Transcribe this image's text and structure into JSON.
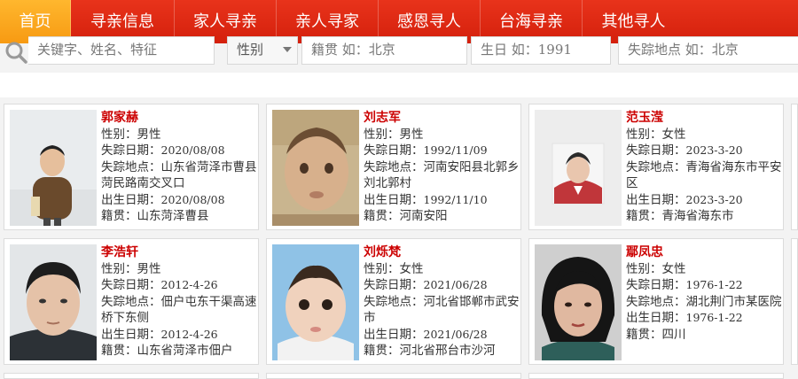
{
  "nav": {
    "items": [
      {
        "label": "首页",
        "active": true
      },
      {
        "label": "寻亲信息"
      },
      {
        "label": "家人寻亲"
      },
      {
        "label": "亲人寻家"
      },
      {
        "label": "感恩寻人"
      },
      {
        "label": "台海寻亲"
      },
      {
        "label": "其他寻人"
      }
    ]
  },
  "search": {
    "keyword_placeholder": "关键字、姓名、特征",
    "gender_label": "性别",
    "hometown_placeholder": "籍贯 如：北京",
    "birthday_placeholder": "生日 如：1991",
    "location_placeholder": "失踪地点 如：北京"
  },
  "labels": {
    "gender": "性别：",
    "missing_date": "失踪日期：",
    "missing_place": "失踪地点：",
    "birth_date": "出生日期：",
    "hometown": "籍贯："
  },
  "persons": [
    {
      "name": "郭家赫",
      "gender": "男性",
      "missing_date": "2020/08/08",
      "missing_place": "山东省菏泽市曹县菏民路南交叉口",
      "birth_date": "2020/08/08",
      "hometown": "山东菏泽曹县"
    },
    {
      "name": "刘志军",
      "gender": "男性",
      "missing_date": "1992/11/09",
      "missing_place": "河南安阳县北郭乡刘北郭村",
      "birth_date": "1992/11/10",
      "hometown": "河南安阳"
    },
    {
      "name": "范玉滢",
      "gender": "女性",
      "missing_date": "2023-3-20",
      "missing_place": "青海省海东市平安区",
      "birth_date": "2023-3-20",
      "hometown": "青海省海东市"
    },
    {
      "name": "李浩轩",
      "gender": "男性",
      "missing_date": "2012-4-26",
      "missing_place": "佃户屯东干渠高速桥下东侧",
      "birth_date": "2012-4-26",
      "hometown": "山东省菏泽市佃户"
    },
    {
      "name": "刘烁梵",
      "gender": "女性",
      "missing_date": "2021/06/28",
      "missing_place": "河北省邯郸市武安市",
      "birth_date": "2021/06/28",
      "hometown": "河北省邢台市沙河"
    },
    {
      "name": "鄢凤忠",
      "gender": "女性",
      "missing_date": "1976-1-22",
      "missing_place": "湖北荆门市某医院",
      "birth_date": "1976-1-22",
      "hometown": "四川"
    }
  ]
}
